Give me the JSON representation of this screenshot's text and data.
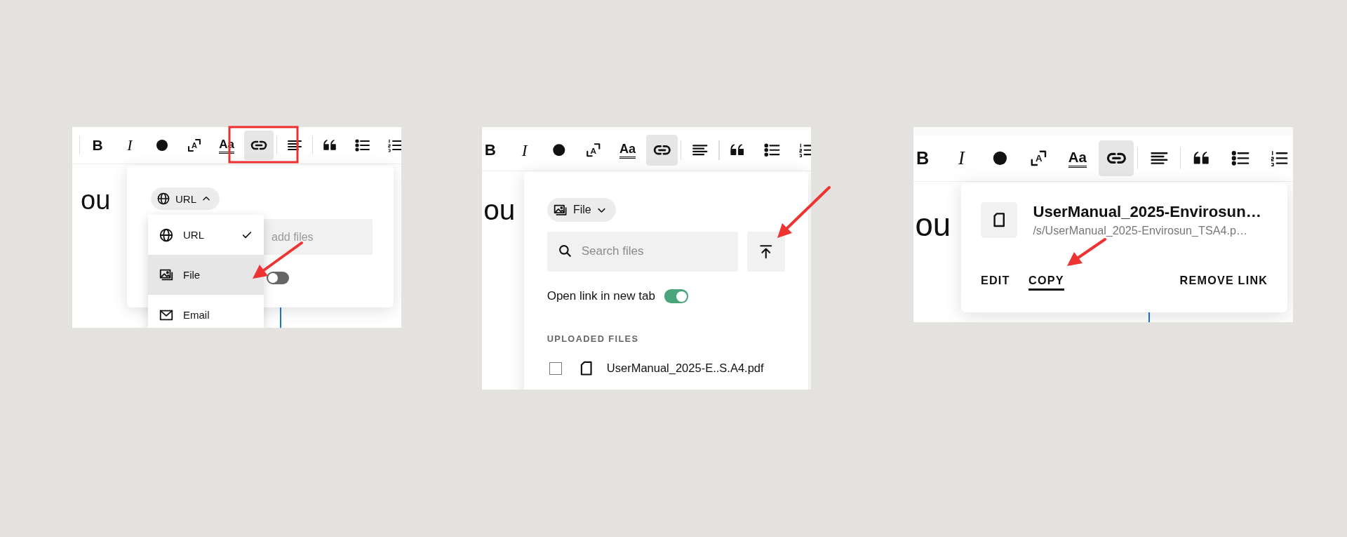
{
  "panels": [
    {
      "kind": "type-menu",
      "toolbar": [
        {
          "kind": "divider"
        },
        {
          "kind": "bold",
          "label": "B",
          "selected": false
        },
        {
          "kind": "italic",
          "label": "I",
          "selected": false
        },
        {
          "kind": "color",
          "selected": false
        },
        {
          "kind": "size",
          "label": "A",
          "selected": false
        },
        {
          "kind": "format",
          "label": "Aa",
          "selected": false
        },
        {
          "kind": "link",
          "selected": true
        },
        {
          "kind": "divider"
        },
        {
          "kind": "align",
          "selected": false
        },
        {
          "kind": "divider"
        },
        {
          "kind": "quote",
          "selected": false
        },
        {
          "kind": "bullets",
          "selected": false
        },
        {
          "kind": "numbers",
          "selected": false
        }
      ],
      "heading": "ou",
      "chip": {
        "label": "URL",
        "kind": "url",
        "expanded": true
      },
      "field": {
        "placeholder": "add files"
      },
      "toggle": {
        "on": false
      },
      "menu": [
        {
          "label": "URL",
          "kind": "url",
          "checked": true,
          "selected": false
        },
        {
          "label": "File",
          "kind": "file",
          "checked": false,
          "selected": true
        },
        {
          "label": "Email",
          "kind": "email",
          "checked": false,
          "selected": false
        }
      ]
    },
    {
      "kind": "file-picker",
      "toolbar": [
        {
          "kind": "bold",
          "label": "B",
          "selected": false
        },
        {
          "kind": "italic",
          "label": "I",
          "selected": false
        },
        {
          "kind": "color",
          "selected": false
        },
        {
          "kind": "size",
          "label": "A",
          "selected": false
        },
        {
          "kind": "format",
          "label": "Aa",
          "selected": false
        },
        {
          "kind": "link",
          "selected": true
        },
        {
          "kind": "divider"
        },
        {
          "kind": "align",
          "selected": false
        },
        {
          "kind": "divider"
        },
        {
          "kind": "quote",
          "selected": false
        },
        {
          "kind": "bullets",
          "selected": false
        },
        {
          "kind": "numbers",
          "selected": false
        }
      ],
      "heading": "ou",
      "chip": {
        "label": "File",
        "kind": "file",
        "expanded": false
      },
      "search": {
        "placeholder": "Search files"
      },
      "toggle": {
        "label": "Open link in new tab",
        "on": true
      },
      "section_title": "UPLOADED FILES",
      "files": [
        {
          "name": "UserManual_2025-E..S.A4.pdf",
          "checked": false
        }
      ]
    },
    {
      "kind": "link-preview",
      "toolbar": [
        {
          "kind": "bold",
          "label": "B",
          "selected": false
        },
        {
          "kind": "italic",
          "label": "I",
          "selected": false
        },
        {
          "kind": "color",
          "selected": false
        },
        {
          "kind": "size",
          "label": "A",
          "selected": false
        },
        {
          "kind": "format",
          "label": "Aa",
          "selected": false
        },
        {
          "kind": "link",
          "selected": true
        },
        {
          "kind": "divider"
        },
        {
          "kind": "align",
          "selected": false
        },
        {
          "kind": "divider"
        },
        {
          "kind": "quote",
          "selected": false
        },
        {
          "kind": "bullets",
          "selected": false
        },
        {
          "kind": "numbers",
          "selected": false
        }
      ],
      "heading": "ou",
      "title": "UserManual_2025-Envirosun…",
      "path": "/s/UserManual_2025-Envirosun_TSA4.p…",
      "actions": [
        {
          "label": "EDIT",
          "selected": false
        },
        {
          "label": "COPY",
          "selected": true
        },
        {
          "label": "REMOVE LINK",
          "selected": false
        }
      ]
    }
  ]
}
